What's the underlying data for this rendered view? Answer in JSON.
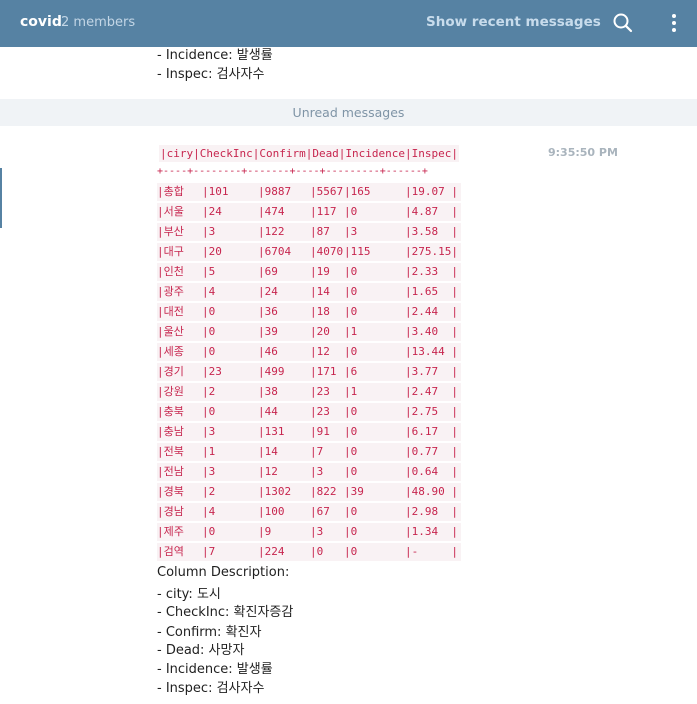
{
  "header": {
    "title": "covid",
    "members": "2 members",
    "recent_label": "Show recent messages"
  },
  "top_lines": [
    "- Incidence: 발생률",
    "- Inspec: 검사자수"
  ],
  "unread_label": "Unread messages",
  "message": {
    "time": "9:35:50 PM",
    "header_line": "|ciry|CheckInc|Confirm|Dead|Incidence|Inspec|",
    "separator": "+----+--------+-------+----+---------+------+",
    "rows": [
      [
        "|총합",
        "|101",
        "|9887",
        "|5567",
        "|165",
        "|19.07 |"
      ],
      [
        "|서울",
        "|24",
        "|474",
        "|117",
        "|0",
        "|4.87  |"
      ],
      [
        "|부산",
        "|3",
        "|122",
        "|87",
        "|3",
        "|3.58  |"
      ],
      [
        "|대구",
        "|20",
        "|6704",
        "|4070",
        "|115",
        "|275.15|"
      ],
      [
        "|인천",
        "|5",
        "|69",
        "|19",
        "|0",
        "|2.33  |"
      ],
      [
        "|광주",
        "|4",
        "|24",
        "|14",
        "|0",
        "|1.65  |"
      ],
      [
        "|대전",
        "|0",
        "|36",
        "|18",
        "|0",
        "|2.44  |"
      ],
      [
        "|울산",
        "|0",
        "|39",
        "|20",
        "|1",
        "|3.40  |"
      ],
      [
        "|세종",
        "|0",
        "|46",
        "|12",
        "|0",
        "|13.44 |"
      ],
      [
        "|경기",
        "|23",
        "|499",
        "|171",
        "|6",
        "|3.77  |"
      ],
      [
        "|강원",
        "|2",
        "|38",
        "|23",
        "|1",
        "|2.47  |"
      ],
      [
        "|충북",
        "|0",
        "|44",
        "|23",
        "|0",
        "|2.75  |"
      ],
      [
        "|충남",
        "|3",
        "|131",
        "|91",
        "|0",
        "|6.17  |"
      ],
      [
        "|전북",
        "|1",
        "|14",
        "|7",
        "|0",
        "|0.77  |"
      ],
      [
        "|전남",
        "|3",
        "|12",
        "|3",
        "|0",
        "|0.64  |"
      ],
      [
        "|경북",
        "|2",
        "|1302",
        "|822",
        "|39",
        "|48.90 |"
      ],
      [
        "|경남",
        "|4",
        "|100",
        "|67",
        "|0",
        "|2.98  |"
      ],
      [
        "|제주",
        "|0",
        "|9",
        "|3",
        "|0",
        "|1.34  |"
      ],
      [
        "|검역",
        "|7",
        "|224",
        "|0",
        "|0",
        "|-     |"
      ]
    ],
    "description_title": "Column Description:",
    "description_lines": [
      "- city: 도시",
      "- CheckInc: 확진자증감",
      "- Confirm: 확진자",
      "- Dead: 사망자",
      "- Incidence: 발생률",
      "- Inspec: 검사자수"
    ]
  },
  "colors": {
    "header_bg": "#5682a3",
    "code_text": "#c7254e",
    "code_bg": "#f9f2f4"
  },
  "icons": [
    "search-icon",
    "more-vertical-icon"
  ]
}
